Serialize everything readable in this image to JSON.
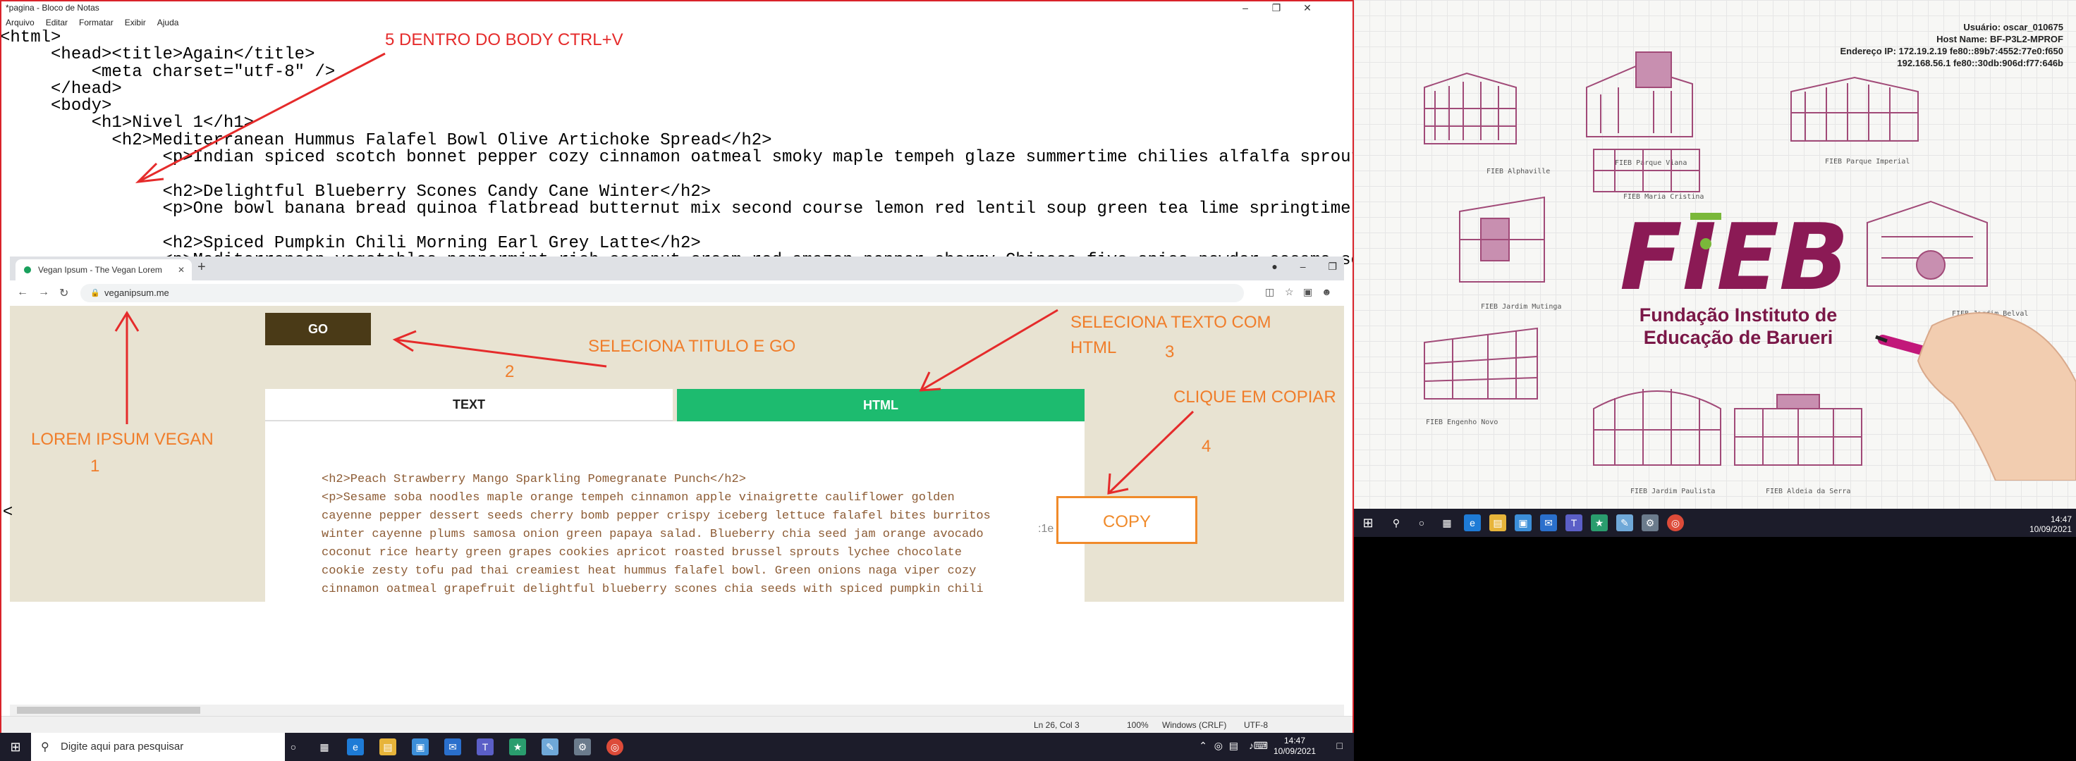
{
  "notepad": {
    "title": "*pagina - Bloco de Notas",
    "menu": [
      "Arquivo",
      "Editar",
      "Formatar",
      "Exibir",
      "Ajuda"
    ],
    "lines": [
      "<html>",
      "     <head><title>Again</title>",
      "         <meta charset=\"utf-8\" />",
      "     </head>",
      "     <body>",
      "         <h1>Nivel 1</h1>",
      "           <h2>Mediterranean Hummus Falafel Bowl Olive Artichoke Spread</h2>",
      "                <p>Indian spiced scotch bonnet pepper cozy cinnamon oatmeal smoky maple tempeh glaze summertime chilies alfalfa sprouts",
      "",
      "                <h2>Delightful Blueberry Scones Candy Cane Winter</h2>",
      "                <p>One bowl banana bread quinoa flatbread butternut mix second course lemon red lentil soup green tea lime springtime st",
      "",
      "                <h2>Spiced Pumpkin Chili Morning Earl Grey Latte</h2>",
      "                <p>Mediterranean vegetables peppermint rich coconut cream red amazon pepper cherry Chinese five-spice powder sesame soba"
    ],
    "status": {
      "position": "Ln 26, Col 3",
      "zoom": "100%",
      "line_ending": "Windows (CRLF)",
      "encoding": "UTF-8"
    }
  },
  "browser": {
    "tab_title": "Vegan Ipsum - The Vegan Lorem",
    "url": "veganipsum.me",
    "go_label": "GO",
    "tab_text_label": "TEXT",
    "tab_html_label": "HTML",
    "output_lines": [
      "<h2>Peach Strawberry Mango Sparkling Pomegranate Punch</h2>",
      "<p>Sesame soba noodles maple orange tempeh cinnamon apple vinaigrette cauliflower golden",
      "cayenne pepper dessert seeds cherry bomb pepper crispy iceberg lettuce falafel bites burritos",
      "winter cayenne plums samosa onion green papaya salad. Blueberry chia seed jam orange avocado",
      "coconut rice hearty green grapes cookies apricot roasted brussel sprouts lychee chocolate",
      "cookie zesty tofu pad thai creamiest heat hummus falafel bowl. Green onions naga viper cozy",
      "cinnamon oatmeal grapefruit delightful blueberry scones chia seeds with spiced pumpkin chili"
    ],
    "copy_label": "COPY",
    "copy_left_hint": ":1e"
  },
  "annotations": {
    "step5": "5 DENTRO DO BODY CTRL+V",
    "step2_label": "SELECIONA TITULO E GO",
    "step2_num": "2",
    "step3_label_a": "SELECIONA TEXTO COM",
    "step3_label_b": "HTML",
    "step3_num": "3",
    "step4_label": "CLIQUE EM COPIAR",
    "step4_num": "4",
    "step1_label": "LOREM IPSUM VEGAN",
    "step1_num": "1"
  },
  "taskbar_left": {
    "search_placeholder": "Digite aqui para pesquisar",
    "time": "14:47",
    "date": "10/09/2021"
  },
  "desktop_right": {
    "sysinfo": [
      "Usuário: oscar_010675",
      "Host Name: BF-P3L2-MPROF",
      "Endereço IP: 172.19.2.19 fe80::89b7:4552:77e0:f650",
      "192.168.56.1 fe80::30db:906d:f77:646b"
    ],
    "campus_labels": [
      "FIEB Alphaville",
      "FIEB Parque Viana",
      "FIEB Parque Imperial",
      "FIEB Maria Cristina",
      "FIEB Jardim Mutinga",
      "FIEB Jardim Belval",
      "FIEB Engenho Novo",
      "FIEB Jardim Paulista",
      "FIEB Aldeia da Serra"
    ],
    "logo_letters": "FIEB",
    "org_line1": "Fundação Instituto de",
    "org_line2": "Educação de Barueri",
    "time": "14:47",
    "date": "10/09/2021"
  },
  "colors": {
    "annotation_orange": "#f07d2a",
    "annotation_red": "#e52b2b",
    "go_button": "#4a3a17",
    "html_tab": "#1dbb6f",
    "page_bg": "#e8e3d2",
    "fieb_magenta": "#8b1a55"
  }
}
